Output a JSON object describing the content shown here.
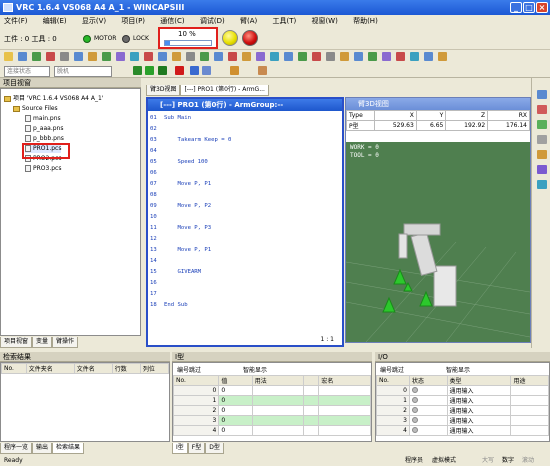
{
  "window": {
    "title": "VRC 1.6.4 VS068 A4 A_1 - WINCAPSIII"
  },
  "menu": [
    "文件(F)",
    "编辑(E)",
    "显示(V)",
    "项目(P)",
    "通信(C)",
    "调试(D)",
    "臂(A)",
    "工具(T)",
    "视窗(W)",
    "帮助(H)"
  ],
  "status": {
    "work_label": "工件 : 0 工具 : 0",
    "motor_label": "MOTOR",
    "lock_label": "LOCK",
    "speed_percent_label": "10 %",
    "speed_fraction": 0.1
  },
  "toolbar2": {
    "combo1": "连接状态",
    "combo2": "脱机"
  },
  "project": {
    "header": "项目视窗",
    "root": "项目 'VRC 1.6.4 VS068 A4 A_1'",
    "folder": "Source Files",
    "files": [
      "main.pns",
      "p_aaa.pns",
      "p_bbb.pns",
      "PRO1.pcs",
      "PRO2.pcs",
      "PRO3.pcs"
    ],
    "tabs": [
      "项目视窗",
      "变量",
      "臂操作"
    ]
  },
  "doc_tabs": [
    "臂3D视图",
    "[---] PRO1 (第0行) - ArmG..."
  ],
  "editor": {
    "title": "[---] PRO1 (第0行) - ArmGroup:--",
    "lines": [
      "Sub Main",
      "",
      "    Takearm Keep = 0",
      "",
      "    Speed 100",
      "",
      "    Move P, P1",
      "",
      "    Move P, P2",
      "",
      "    Move P, P3",
      "",
      "    Move P, P1",
      "",
      "    GIVEARM",
      "",
      "",
      "End Sub"
    ],
    "line_numbers": [
      "01",
      "02",
      "03",
      "04",
      "05",
      "06",
      "07",
      "08",
      "09",
      "10",
      "11",
      "12",
      "13",
      "14",
      "15",
      "16",
      "17",
      "18"
    ],
    "cursor_pos": "1 : 1"
  },
  "view3d": {
    "title": "臂3D视图",
    "headers": [
      "Type",
      "X",
      "Y",
      "Z",
      "RX"
    ],
    "row": [
      "P型",
      "529.63",
      "6.65",
      "192.92",
      "176.14"
    ],
    "overlay1": "WORK = 0",
    "overlay2": "TOOL = 0"
  },
  "search": {
    "header": "检索结果",
    "columns": [
      "No.",
      "文件夹名",
      "文件名",
      "行数",
      "列位"
    ],
    "tabs": [
      "程序一览",
      "输出",
      "检索结果"
    ]
  },
  "ivars": {
    "header": "I型",
    "toolbar": [
      "编号跳过",
      "智能显示"
    ],
    "columns": [
      "No.",
      "值",
      "用法",
      "",
      "宏名"
    ],
    "rows": [
      [
        "0",
        "0"
      ],
      [
        "1",
        "0"
      ],
      [
        "2",
        "0"
      ],
      [
        "3",
        "0"
      ],
      [
        "4",
        "0"
      ]
    ],
    "tabs": [
      "I型",
      "F型",
      "D型"
    ]
  },
  "io": {
    "header": "I/O",
    "toolbar": [
      "编号跳过",
      "智能显示"
    ],
    "columns": [
      "No.",
      "状态",
      "类型",
      "用途"
    ],
    "rows": [
      [
        "0",
        "通用输入"
      ],
      [
        "1",
        "通用输入"
      ],
      [
        "2",
        "通用输入"
      ],
      [
        "3",
        "通用输入"
      ],
      [
        "4",
        "通用输入"
      ]
    ]
  },
  "statusbar": {
    "left": "Ready",
    "program": "程序员",
    "mode": "虚拟模式",
    "r1": "大写",
    "r2": "数字",
    "r3": "滚动"
  }
}
